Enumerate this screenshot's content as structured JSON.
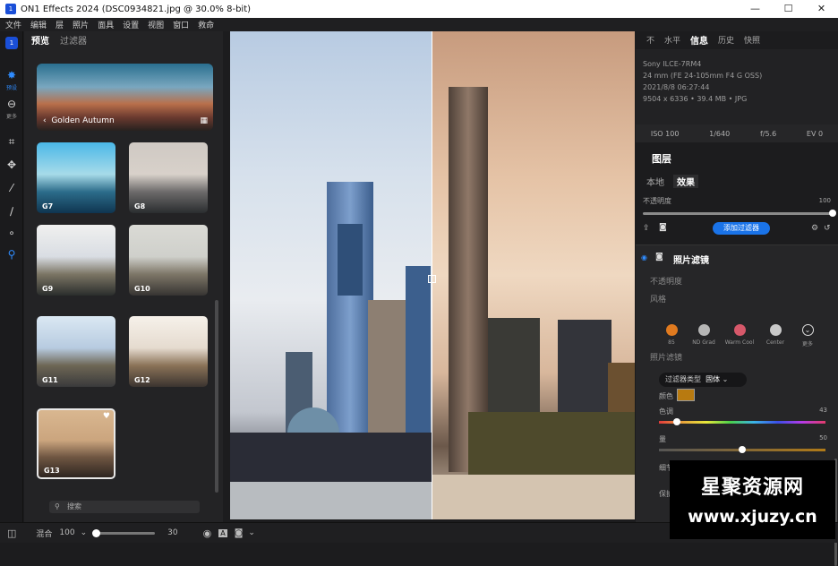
{
  "window": {
    "title": "ON1 Effects 2024 (DSC0934821.jpg @ 30.0% 8-bit)",
    "minimize_icon": "minimize-icon",
    "maximize_icon": "maximize-icon",
    "close_icon": "close-icon"
  },
  "menu": [
    "文件",
    "编辑",
    "层",
    "照片",
    "面具",
    "设置",
    "视图",
    "窗口",
    "救命"
  ],
  "left_tools": {
    "presets_label": "预设",
    "more_label": "更多"
  },
  "preset_panel": {
    "tabs": [
      "预览",
      "过滤器"
    ],
    "active_tab": 0,
    "category": "Golden Autumn",
    "thumbnails": [
      "G7",
      "G8",
      "G9",
      "G10",
      "G11",
      "G12",
      "G13"
    ],
    "selected": "G13",
    "search_placeholder": "搜索"
  },
  "right_panel": {
    "tabs": [
      "不",
      "水平",
      "信息",
      "历史",
      "快照"
    ],
    "active_tab": 2,
    "info": {
      "camera": "Sony ILCE-7RM4",
      "lens": "24 mm (FE 24-105mm F4 G OSS)",
      "datetime": "2021/8/8  06:27:44",
      "size": "9504 x 6336 • 39.4 MB • JPG"
    },
    "exif": {
      "iso": "ISO 100",
      "shutter": "1/640",
      "aperture": "f/5.6",
      "ev": "EV 0"
    },
    "layers_heading": "图层",
    "layer_tabs": [
      "本地",
      "效果"
    ],
    "active_layer_tab": 1,
    "opacity_label": "不透明度",
    "opacity_value": "100",
    "opacity_level": 1.0,
    "add_filter_label": "添加过滤器",
    "filter": {
      "title": "照片滤镜",
      "opacity_label": "不透明度",
      "style_label": "风格",
      "styles": [
        {
          "name": "85",
          "color": "#e07a1f"
        },
        {
          "name": "ND Grad",
          "color": "#b5b5b5"
        },
        {
          "name": "Warm Cool",
          "color": "#d6586a"
        },
        {
          "name": "Center",
          "color": "#c9c9c9"
        },
        {
          "name": "更多",
          "color": "#2a2a2a"
        }
      ],
      "section_label": "照片滤镜",
      "filter_type_label": "过滤器类型",
      "filter_type_value": "固体",
      "color_label": "颜色",
      "color_value": "#b87a10",
      "hue_label": "色调",
      "hue_value": "43",
      "hue_level": 0.11,
      "amount_label": "量",
      "amount_value": "50",
      "amount_level": 0.5,
      "truncated_label_1": "细节",
      "truncated_label_2": "保护"
    }
  },
  "bottom_bar": {
    "mix_label": "混合",
    "mix_value": "100",
    "zoom_value": "30"
  },
  "watermark": {
    "line1": "星聚资源网",
    "line2": "www.xjuzy.cn"
  }
}
